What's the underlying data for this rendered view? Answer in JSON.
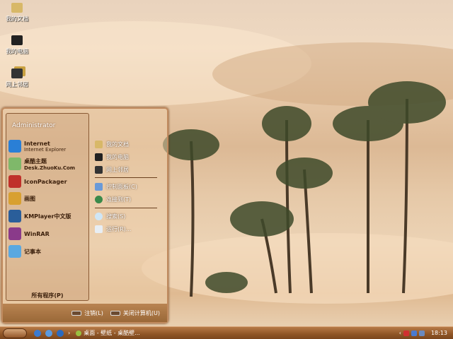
{
  "desktop": {
    "icons": [
      {
        "label": "我的文档",
        "icon": "folder-icon"
      },
      {
        "label": "我的电脑",
        "icon": "computer-icon"
      },
      {
        "label": "网上邻居",
        "icon": "network-icon"
      }
    ]
  },
  "start_menu": {
    "user": "Administrator",
    "programs": [
      {
        "title": "Internet",
        "subtitle": "Internet Explorer",
        "icon": "ie-icon",
        "color": "#2a7fd6"
      },
      {
        "title": "桌酷主题",
        "subtitle": "Desk.ZhuoKu.Com",
        "icon": "theme-icon",
        "color": "#7fb86a"
      },
      {
        "title": "IconPackager",
        "subtitle": "",
        "icon": "iconpackager-icon",
        "color": "#c0302a"
      },
      {
        "title": "画图",
        "subtitle": "",
        "icon": "paint-icon",
        "color": "#d8a030"
      },
      {
        "title": "KMPlayer中文版",
        "subtitle": "",
        "icon": "kmplayer-icon",
        "color": "#2a5e9a"
      },
      {
        "title": "WinRAR",
        "subtitle": "",
        "icon": "winrar-icon",
        "color": "#8a3a8a"
      },
      {
        "title": "记事本",
        "subtitle": "",
        "icon": "notepad-icon",
        "color": "#5aa8e0"
      }
    ],
    "all_programs": "所有程序(P)",
    "places": [
      {
        "label": "我的文档",
        "icon": "folder-icon"
      },
      {
        "label": "我的电脑",
        "icon": "computer-icon"
      },
      {
        "label": "网上邻居",
        "icon": "network-icon"
      }
    ],
    "system": [
      {
        "label": "控制面板(C)",
        "icon": "control-panel-icon"
      },
      {
        "label": "连接到(T)",
        "icon": "connect-icon"
      }
    ],
    "tools": [
      {
        "label": "搜索(S)",
        "icon": "search-icon"
      },
      {
        "label": "运行(R)...",
        "icon": "run-icon"
      }
    ],
    "logoff": "注销(L)",
    "shutdown": "关闭计算机(U)"
  },
  "taskbar": {
    "task": "桌面 - 壁纸 - 桌酷壁...",
    "clock": "18:13",
    "arrow": "›",
    "tray_arrow": "‹"
  }
}
